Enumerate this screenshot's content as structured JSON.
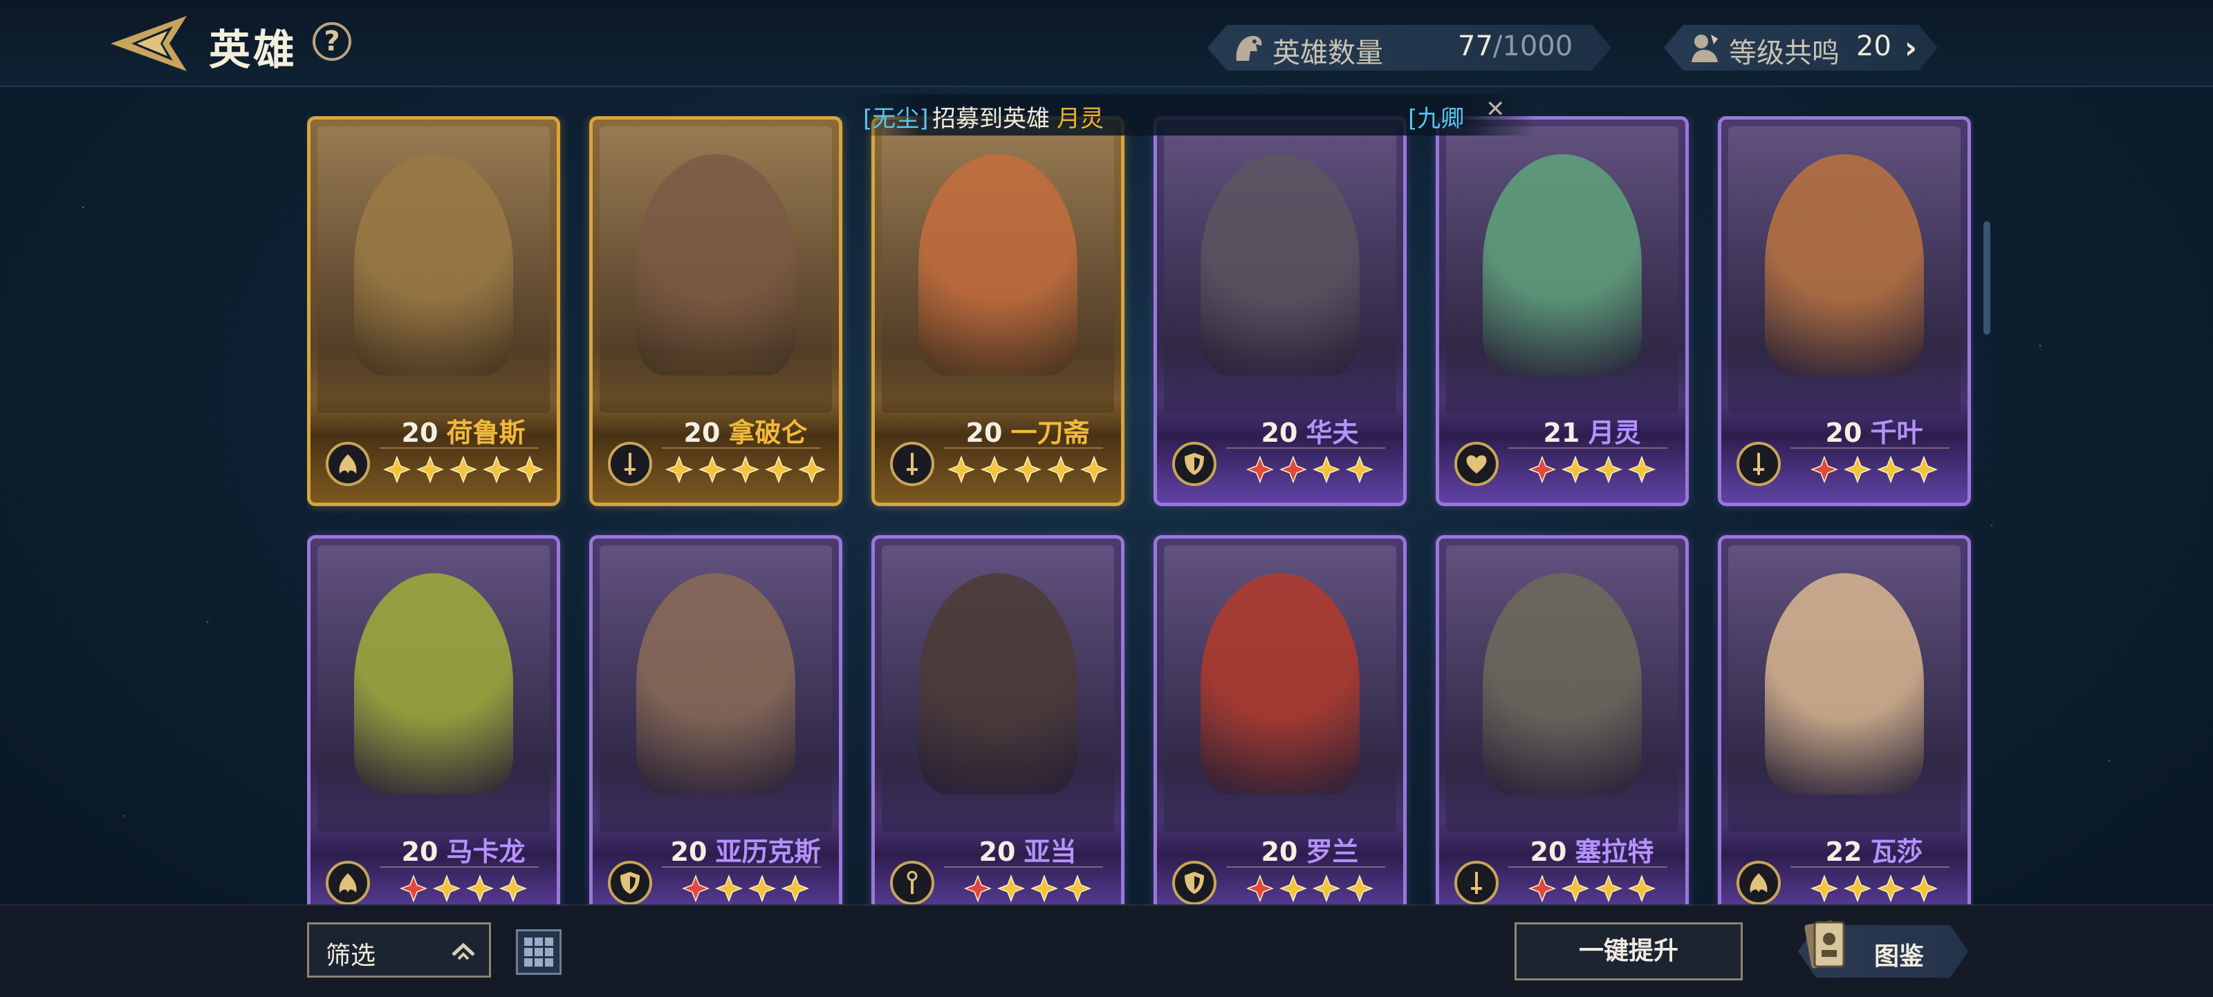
{
  "header": {
    "title": "英雄",
    "help_glyph": "?",
    "hero_count_label": "英雄数量",
    "hero_count_value": "77",
    "hero_count_max": "/1000",
    "resonance_label": "等级共鸣",
    "resonance_value": "20"
  },
  "notice": {
    "name": "[无尘]",
    "text": "招募到英雄",
    "hero": "月灵",
    "name2": "[九卿",
    "close_glyph": "✕"
  },
  "heroes": [
    {
      "level": "20",
      "name": "荷鲁斯",
      "rarity": "gold",
      "role": "wings",
      "stars": [
        "gold",
        "gold",
        "gold",
        "gold",
        "gold"
      ],
      "tint": "#9a7a45"
    },
    {
      "level": "20",
      "name": "拿破仑",
      "rarity": "gold",
      "role": "sword",
      "stars": [
        "gold",
        "gold",
        "gold",
        "gold",
        "gold"
      ],
      "tint": "#7b5a44"
    },
    {
      "level": "20",
      "name": "一刀斋",
      "rarity": "gold",
      "role": "sword",
      "stars": [
        "gold",
        "gold",
        "gold",
        "gold",
        "gold"
      ],
      "tint": "#c56d3d"
    },
    {
      "level": "20",
      "name": "华夫",
      "rarity": "purple",
      "role": "shield",
      "stars": [
        "red",
        "red",
        "gold",
        "gold"
      ],
      "tint": "#5b5560"
    },
    {
      "level": "21",
      "name": "月灵",
      "rarity": "purple",
      "role": "heart",
      "stars": [
        "red",
        "gold",
        "gold",
        "gold"
      ],
      "tint": "#5fa37b"
    },
    {
      "level": "20",
      "name": "千叶",
      "rarity": "purple",
      "role": "sword",
      "stars": [
        "red",
        "gold",
        "gold",
        "gold"
      ],
      "tint": "#b9733f"
    },
    {
      "level": "20",
      "name": "马卡龙",
      "rarity": "purple",
      "role": "wings",
      "stars": [
        "red",
        "gold",
        "gold",
        "gold"
      ],
      "tint": "#9fae3a"
    },
    {
      "level": "20",
      "name": "亚历克斯",
      "rarity": "purple",
      "role": "shield",
      "stars": [
        "red",
        "gold",
        "gold",
        "gold"
      ],
      "tint": "#8a6b55"
    },
    {
      "level": "20",
      "name": "亚当",
      "rarity": "purple",
      "role": "staff",
      "stars": [
        "red",
        "gold",
        "gold",
        "gold"
      ],
      "tint": "#4b3b35"
    },
    {
      "level": "20",
      "name": "罗兰",
      "rarity": "purple",
      "role": "shield",
      "stars": [
        "red",
        "gold",
        "gold",
        "gold"
      ],
      "tint": "#b23a2a"
    },
    {
      "level": "20",
      "name": "塞拉特",
      "rarity": "purple",
      "role": "sword",
      "stars": [
        "red",
        "gold",
        "gold",
        "gold"
      ],
      "tint": "#6d6a5a"
    },
    {
      "level": "22",
      "name": "瓦莎",
      "rarity": "purple",
      "role": "wings",
      "stars": [
        "gold",
        "gold",
        "gold",
        "gold"
      ],
      "tint": "#d9b78f"
    }
  ],
  "footer": {
    "filter_label": "筛选",
    "upgrade_label": "一键提升",
    "codex_label": "图鉴"
  },
  "colors": {
    "gold_frame": "#d8a53c",
    "purple_frame": "#9a77d8",
    "gold_star": "#f2c33d",
    "red_star": "#e0493d",
    "notice_name": "#57c7ef",
    "notice_hero": "#f0b232"
  }
}
